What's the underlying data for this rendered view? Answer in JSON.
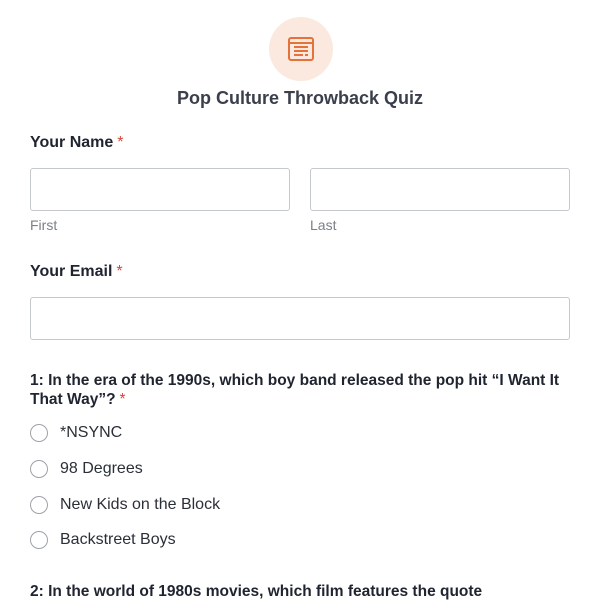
{
  "form": {
    "title": "Pop Culture Throwback Quiz",
    "logo_icon": "form-document-icon",
    "accent_color": "#e3733a",
    "required_marker": "*"
  },
  "name_field": {
    "label": "Your Name",
    "first_value": "",
    "last_value": "",
    "first_sublabel": "First",
    "last_sublabel": "Last"
  },
  "email_field": {
    "label": "Your Email",
    "value": ""
  },
  "questions": [
    {
      "text": "1: In the era of the 1990s, which boy band released the pop hit “I Want It That Way”?",
      "options": [
        "*NSYNC",
        "98 Degrees",
        "New Kids on the Block",
        "Backstreet Boys"
      ]
    },
    {
      "text": "2: In the world of 1980s movies, which film features the quote"
    }
  ]
}
